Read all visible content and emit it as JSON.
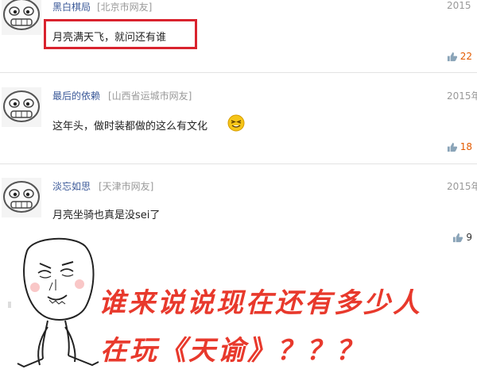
{
  "comments": [
    {
      "username": "黑白棋局",
      "location": "[北京市网友]",
      "date": "2015",
      "text": "月亮满天飞，就问还有谁",
      "likes": "22"
    },
    {
      "username": "最后的依赖",
      "location": "[山西省运城市网友]",
      "date": "2015年",
      "text": "这年头，做时装都做的这么有文化",
      "likes": "18"
    },
    {
      "username": "淡忘如思",
      "location": "[天津市网友]",
      "date": "2015年",
      "text": "月亮坐骑也真是没sei了",
      "likes": "9"
    }
  ],
  "overlay": {
    "line1": "谁来说说现在还有多少人",
    "line2": "在玩《天谕》？？？"
  },
  "colors": {
    "highlight": "#d9232e",
    "overlay_text": "#e8392c",
    "like_count": "#e35b00",
    "username": "#3b5998"
  },
  "icons": {
    "avatar": "grimace-face-avatar-icon",
    "like": "thumbs-up-icon",
    "emoji": "squinting-emoji-icon",
    "meme": "rage-comic-guy-icon"
  }
}
